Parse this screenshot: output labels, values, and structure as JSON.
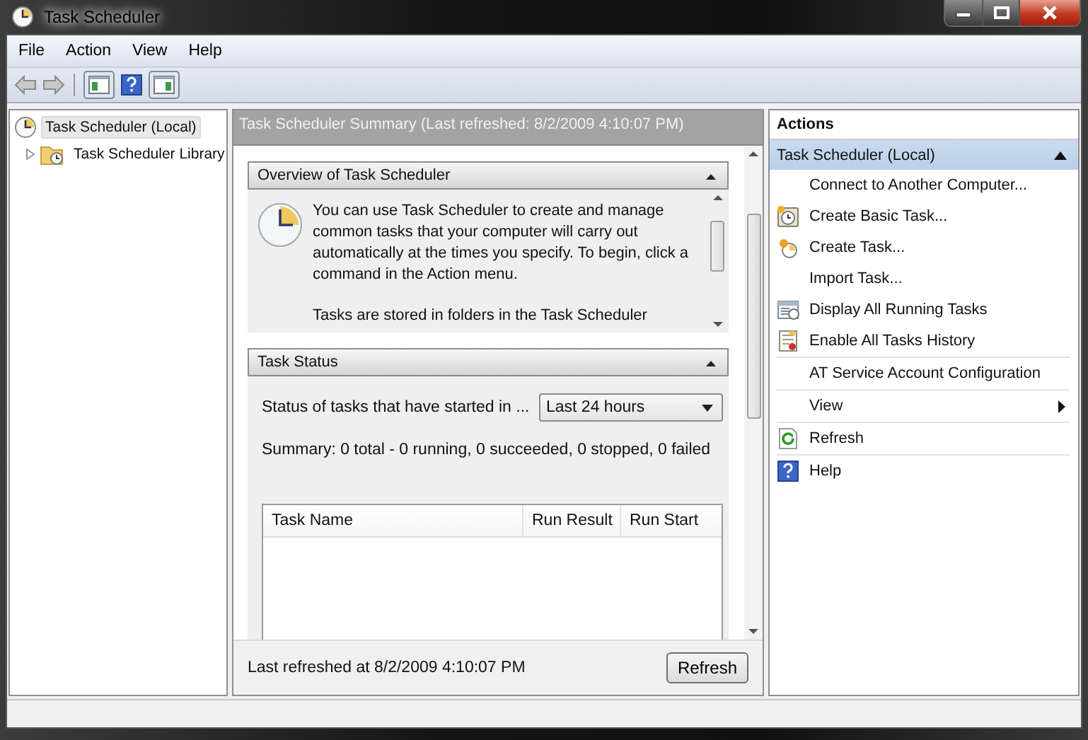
{
  "window": {
    "title": "Task Scheduler"
  },
  "menu": [
    "File",
    "Action",
    "View",
    "Help"
  ],
  "tree": [
    {
      "label": "Task Scheduler (Local)",
      "selected": true,
      "children": [
        {
          "label": "Task Scheduler Library",
          "selected": false,
          "expanded": false
        }
      ]
    }
  ],
  "center": {
    "header": "Task Scheduler Summary (Last refreshed: 8/2/2009 4:10:07 PM)",
    "sections": [
      {
        "kind": "overview",
        "title": "Overview of Task Scheduler",
        "expanded": true,
        "paragraphs": [
          "You can use Task Scheduler to create and manage common tasks that your computer will carry out automatically at the times you specify. To begin, click a command in the Action menu.",
          "Tasks are stored in folders in the Task Scheduler"
        ]
      },
      {
        "kind": "status",
        "title": "Task Status",
        "expanded": true,
        "filter_label": "Status of tasks that have started in ...",
        "filter_value": "Last 24 hours",
        "summary": "Summary: 0 total - 0 running, 0 succeeded, 0 stopped, 0 failed",
        "columns": [
          "Task Name",
          "Run Result",
          "Run Start"
        ]
      }
    ],
    "footer": {
      "text": "Last refreshed at 8/2/2009 4:10:07 PM",
      "button": "Refresh"
    }
  },
  "actions": {
    "title": "Actions",
    "groups": [
      {
        "title": "Task Scheduler (Local)",
        "expanded": true,
        "items": [
          {
            "label": "Connect to Another Computer...",
            "kind": "plain",
            "separator_after": false
          },
          {
            "label": "Create Basic Task...",
            "kind": "basic",
            "separator_after": false
          },
          {
            "label": "Create Task...",
            "kind": "task",
            "separator_after": false
          },
          {
            "label": "Import Task...",
            "kind": "plain",
            "separator_after": false
          },
          {
            "label": "Display All Running Tasks",
            "kind": "running",
            "separator_after": false
          },
          {
            "label": "Enable All Tasks History",
            "kind": "history",
            "separator_after": true
          },
          {
            "label": "AT Service Account Configuration",
            "kind": "plain",
            "separator_after": true
          },
          {
            "label": "View",
            "kind": "submenu",
            "separator_after": true
          },
          {
            "label": "Refresh",
            "kind": "refresh",
            "separator_after": true
          },
          {
            "label": "Help",
            "kind": "help",
            "separator_after": false
          }
        ]
      }
    ]
  }
}
